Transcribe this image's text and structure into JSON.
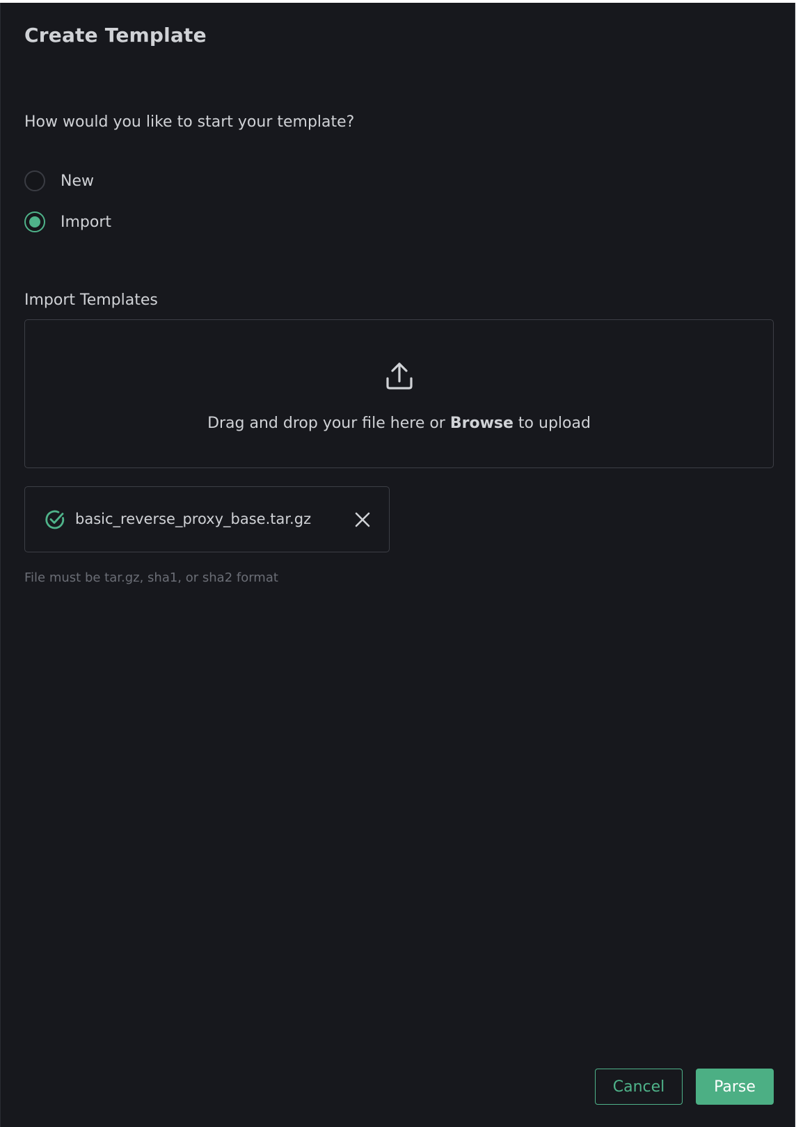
{
  "dialog": {
    "title": "Create Template",
    "question": "How would you like to start your template?",
    "options": [
      {
        "label": "New",
        "selected": false
      },
      {
        "label": "Import",
        "selected": true
      }
    ],
    "import_section": {
      "label": "Import Templates",
      "dropzone": {
        "icon": "upload-icon",
        "text_before": "Drag and drop your file here or ",
        "browse_label": "Browse",
        "text_after": " to upload"
      },
      "file": {
        "name": "basic_reverse_proxy_base.tar.gz",
        "status_icon": "check-circle-icon",
        "remove_icon": "close-icon"
      },
      "hint": "File must be tar.gz, sha1, or sha2 format"
    },
    "buttons": {
      "cancel_label": "Cancel",
      "parse_label": "Parse"
    }
  },
  "colors": {
    "background": "#17181d",
    "text": "#d0d2d6",
    "accent": "#4fb38a",
    "border": "#3d3f46",
    "hint": "#6b6e76"
  }
}
